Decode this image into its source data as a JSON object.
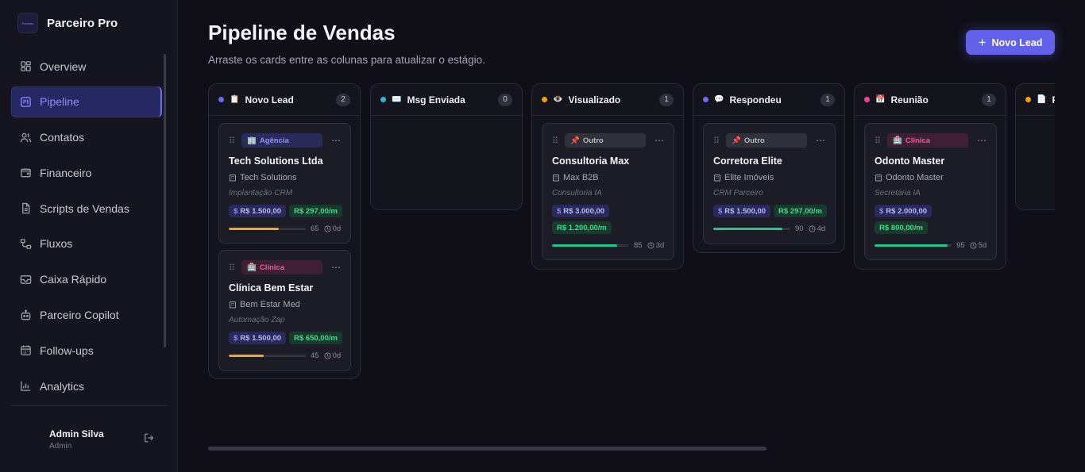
{
  "brand": {
    "logo_text": "Parceiro",
    "name": "Parceiro Pro"
  },
  "nav": [
    {
      "label": "Overview",
      "icon": "grid-icon"
    },
    {
      "label": "Pipeline",
      "icon": "kanban-icon",
      "active": true
    },
    {
      "label": "Contatos",
      "icon": "users-icon"
    },
    {
      "label": "Financeiro",
      "icon": "wallet-icon"
    },
    {
      "label": "Scripts de Vendas",
      "icon": "document-icon"
    },
    {
      "label": "Fluxos",
      "icon": "flow-icon"
    },
    {
      "label": "Caixa Rápido",
      "icon": "inbox-icon"
    },
    {
      "label": "Parceiro Copilot",
      "icon": "bot-icon"
    },
    {
      "label": "Follow-ups",
      "icon": "calendar-icon"
    },
    {
      "label": "Analytics",
      "icon": "bar-chart-icon"
    }
  ],
  "user": {
    "name": "Admin Silva",
    "role": "Admin"
  },
  "header": {
    "title": "Pipeline de Vendas",
    "subtitle": "Arraste os cards entre as colunas para atualizar o estágio.",
    "new_lead_label": "Novo Lead"
  },
  "columns": [
    {
      "title": "Novo Lead",
      "emoji": "📋",
      "count": "2",
      "dot_color": "#6a6cf6"
    },
    {
      "title": "Msg Enviada",
      "emoji": "✉️",
      "count": "0",
      "dot_color": "#2bb2e6"
    },
    {
      "title": "Visualizado",
      "emoji": "👁️",
      "count": "1",
      "dot_color": "#f59e0b"
    },
    {
      "title": "Respondeu",
      "emoji": "💬",
      "count": "1",
      "dot_color": "#6a6cf6"
    },
    {
      "title": "Reunião",
      "emoji": "📅",
      "count": "1",
      "dot_color": "#ec4899"
    },
    {
      "title": "P",
      "emoji": "📄",
      "count": "",
      "dot_color": "#f59e0b"
    }
  ],
  "cards": [
    {
      "tag": "Agência",
      "tag_emoji": "🏢",
      "title": "Tech Solutions Ltda",
      "company": "Tech Solutions",
      "note": "Implantação CRM",
      "setup": "R$ 1.500,00",
      "mrr": "R$ 297,00/m",
      "score": "65",
      "days": "0d",
      "progress": 0.65,
      "bar_color": "#f5a524"
    },
    {
      "tag": "Clínica",
      "tag_emoji": "🏥",
      "title": "Clínica Bem Estar",
      "company": "Bem Estar Med",
      "note": "Automação Zap",
      "setup": "R$ 1.500,00",
      "mrr": "R$ 650,00/m",
      "score": "45",
      "days": "0d",
      "progress": 0.45,
      "bar_color": "#f5a524"
    },
    {
      "tag": "Outro",
      "tag_emoji": "📌",
      "title": "Consultoria Max",
      "company": "Max B2B",
      "note": "Consultoria IA",
      "setup": "R$ 3.000,00",
      "mrr": "R$ 1.200,00/m",
      "score": "85",
      "days": "3d",
      "progress": 0.85,
      "bar_color": "#22c58b"
    },
    {
      "tag": "Outro",
      "tag_emoji": "📌",
      "title": "Corretora Elite",
      "company": "Elite Imóveis",
      "note": "CRM Parceiro",
      "setup": "R$ 1.500,00",
      "mrr": "R$ 297,00/m",
      "score": "90",
      "days": "4d",
      "progress": 0.9,
      "bar_color": "#22c58b"
    },
    {
      "tag": "Clínica",
      "tag_emoji": "🏥",
      "title": "Odonto Master",
      "company": "Odonto Master",
      "note": "Secretária IA",
      "setup": "R$ 2.000,00",
      "mrr": "R$ 800,00/m",
      "score": "95",
      "days": "5d",
      "progress": 0.95,
      "bar_color": "#22c58b"
    }
  ]
}
